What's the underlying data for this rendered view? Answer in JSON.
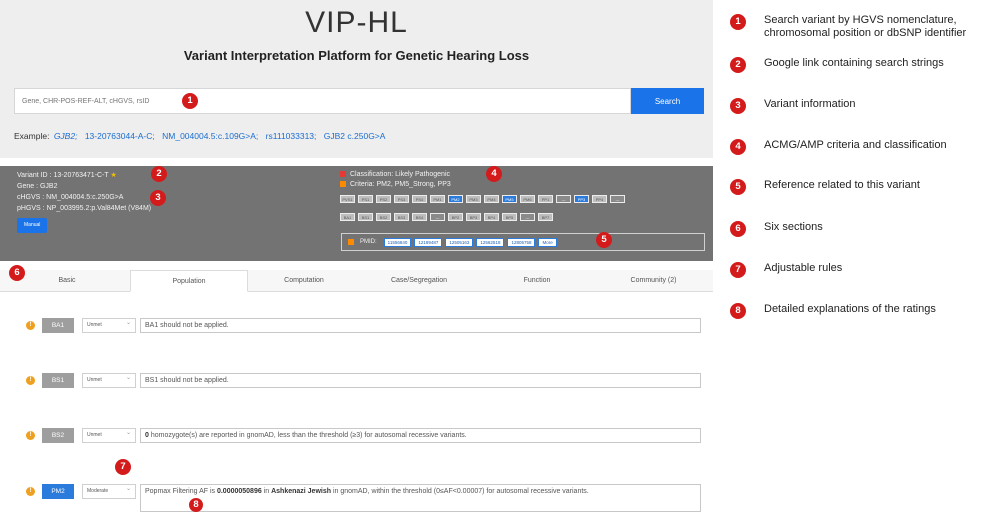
{
  "header": {
    "title": "VIP-HL",
    "subtitle": "Variant Interpretation Platform for Genetic Hearing Loss"
  },
  "search": {
    "placeholder": "Gene, CHR-POS-REF-ALT, cHGVS, rsID",
    "button_label": "Search"
  },
  "examples": {
    "label": "Example:",
    "items": [
      {
        "text": "GJB2;",
        "italic": true
      },
      {
        "text": "13-20763044-A-C;",
        "italic": false
      },
      {
        "text": "NM_004004.5:c.109G>A;",
        "italic": false
      },
      {
        "text": "rs111033313;",
        "italic": false
      },
      {
        "text": "GJB2 c.250G>A",
        "italic": false
      }
    ]
  },
  "variant": {
    "variant_id": "Variant ID : 13-20763471-C-T",
    "star": "★",
    "gene": "Gene : GJB2",
    "chgvs": "cHGVS : NM_004004.5:c.250G>A",
    "phgvs": "pHGVS : NP_003995.2:p.Val84Met (V84M)",
    "manual_label": "Manual"
  },
  "classification": {
    "text": "Classification: Likely Pathogenic",
    "criteria_text": "Criteria: PM2, PM5_Strong, PP3",
    "class_color": "#e53935",
    "criteria_color": "#ff8a00"
  },
  "criteria_rows": [
    [
      {
        "label": "PVS1",
        "on": false
      },
      {
        "label": "PS1",
        "on": false
      },
      {
        "label": "PS2",
        "on": false
      },
      {
        "label": "PS3",
        "on": false
      },
      {
        "label": "PS4",
        "on": false
      },
      {
        "label": "PM1",
        "on": false
      },
      {
        "label": "PM2",
        "on": true
      },
      {
        "label": "PM3",
        "on": false
      },
      {
        "label": "PM4",
        "on": false
      },
      {
        "label": "PM5",
        "on": true
      },
      {
        "label": "PM6",
        "on": false
      },
      {
        "label": "PP1",
        "on": false
      },
      {
        "label": "---",
        "on": false,
        "dash": true
      },
      {
        "label": "PP3",
        "on": true
      },
      {
        "label": "PP4",
        "on": false
      },
      {
        "label": "---",
        "on": false,
        "dash": true
      }
    ],
    [
      {
        "label": "BA1",
        "on": false
      },
      {
        "label": "BS1",
        "on": false
      },
      {
        "label": "BS2",
        "on": false
      },
      {
        "label": "BS3",
        "on": false
      },
      {
        "label": "BS4",
        "on": false
      },
      {
        "label": "---",
        "on": false,
        "dash": true
      },
      {
        "label": "BP2",
        "on": false
      },
      {
        "label": "BP3",
        "on": false
      },
      {
        "label": "BP4",
        "on": false
      },
      {
        "label": "BP5",
        "on": false
      },
      {
        "label": "---",
        "on": false,
        "dash": true
      },
      {
        "label": "BP7",
        "on": false
      }
    ]
  ],
  "pmid": {
    "label": "PMID:",
    "ids": [
      "11556840",
      "12189487",
      "12505163",
      "12562518",
      "12805758"
    ],
    "more_label": "More"
  },
  "tabs": [
    "Basic",
    "Population",
    "Computation",
    "Case/Segregation",
    "Function",
    "Community (2)"
  ],
  "active_tab": 1,
  "rules": [
    {
      "code": "BA1",
      "strength": "Unmet",
      "text_html": "BA1 should not be applied.",
      "blue": false
    },
    {
      "code": "BS1",
      "strength": "Unmet",
      "text_html": "BS1 should not be applied.",
      "blue": false
    },
    {
      "code": "BS2",
      "strength": "Unmet",
      "text_html": "<b>0</b> homozygote(s) are reported in gnomAD, less than the threshold (≥3) for autosomal recessive variants.",
      "blue": false
    },
    {
      "code": "PM2",
      "strength": "Moderate",
      "text_html": "Popmax Filtering AF is <b>0.0000050896</b> in <b>Ashkenazi Jewish</b> in gnomAD, within the threshold (0≤AF&lt;0.00007) for autosomal recessive variants.",
      "blue": true
    }
  ],
  "legend": [
    {
      "num": "1",
      "text": "Search variant by HGVS nomenclature, chromosomal position or dbSNP identifier"
    },
    {
      "num": "2",
      "text": "Google link containing search strings"
    },
    {
      "num": "3",
      "text": "Variant information"
    },
    {
      "num": "4",
      "text": "ACMG/AMP criteria and classification"
    },
    {
      "num": "5",
      "text": "Reference related to this variant"
    },
    {
      "num": "6",
      "text": "Six sections"
    },
    {
      "num": "7",
      "text": "Adjustable rules"
    },
    {
      "num": "8",
      "text": "Detailed explanations of the ratings"
    }
  ],
  "markers": [
    "1",
    "2",
    "3",
    "4",
    "5",
    "6",
    "7",
    "8"
  ]
}
